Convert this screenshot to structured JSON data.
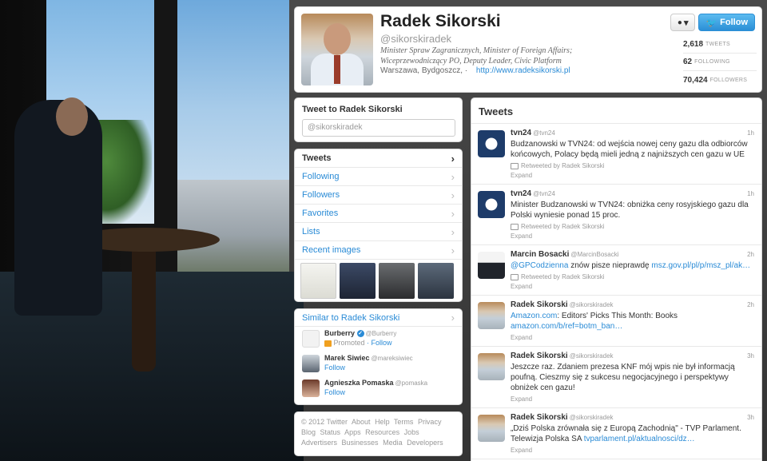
{
  "profile": {
    "name": "Radek Sikorski",
    "handle": "@sikorskiradek",
    "bio": "Minister Spraw Zagranicznych, Minister of Foreign Affairs; Wiceprzewodniczący PO, Deputy Leader, Civic Platform",
    "location": "Warszawa, Bydgoszcz, ·",
    "url": "http://www.radeksikorski.pl",
    "user_dropdown_label": "▾",
    "follow_label": "Follow",
    "stats": [
      {
        "value": "2,618",
        "label": "TWEETS"
      },
      {
        "value": "62",
        "label": "FOLLOWING"
      },
      {
        "value": "70,424",
        "label": "FOLLOWERS"
      }
    ]
  },
  "tweet_to": {
    "title": "Tweet to Radek Sikorski",
    "placeholder": "@sikorskiradek"
  },
  "nav": {
    "items": [
      {
        "label": "Tweets"
      },
      {
        "label": "Following"
      },
      {
        "label": "Followers"
      },
      {
        "label": "Favorites"
      },
      {
        "label": "Lists"
      },
      {
        "label": "Recent images"
      }
    ]
  },
  "similar": {
    "title": "Similar to Radek Sikorski",
    "users": [
      {
        "name": "Burberry",
        "handle": "@Burberry",
        "promoted": "Promoted",
        "follow": "Follow"
      },
      {
        "name": "Marek Siwiec",
        "handle": "@mareksiwiec",
        "follow": "Follow"
      },
      {
        "name": "Agnieszka Pomaska",
        "handle": "@pomaska",
        "follow": "Follow"
      }
    ]
  },
  "footer": {
    "links": [
      "© 2012 Twitter",
      "About",
      "Help",
      "Terms",
      "Privacy",
      "Blog",
      "Status",
      "Apps",
      "Resources",
      "Jobs",
      "Advertisers",
      "Businesses",
      "Media",
      "Developers"
    ]
  },
  "tweets": {
    "header": "Tweets",
    "items": [
      {
        "name": "tvn24",
        "handle": "@tvn24",
        "time": "1h",
        "text": "Budzanowski w TVN24: od wejścia nowej ceny gazu dla odbiorców końcowych, Polacy będą mieli jedną z najniższych cen gazu w UE",
        "link": "",
        "retweet": "Retweeted by Radek Sikorski",
        "expand": "Expand"
      },
      {
        "name": "tvn24",
        "handle": "@tvn24",
        "time": "1h",
        "text": "Minister Budzanowski w TVN24: obniżka ceny rosyjskiego gazu dla Polski wyniesie ponad 15 proc.",
        "link": "",
        "retweet": "Retweeted by Radek Sikorski",
        "expand": "Expand"
      },
      {
        "name": "Marcin Bosacki",
        "handle": "@MarcinBosacki",
        "time": "2h",
        "mention": "@GPCodzienna",
        "text": " znów pisze nieprawdę ",
        "link": "msz.gov.pl/pl/p/msz_pl/ak…",
        "retweet": "Retweeted by Radek Sikorski",
        "expand": "Expand"
      },
      {
        "name": "Radek Sikorski",
        "handle": "@sikorskiradek",
        "time": "2h",
        "link_pre": "Amazon.com",
        "text": ": Editors' Picks This Month: Books ",
        "link": "amazon.com/b/ref=botm_ban…",
        "retweet": "",
        "expand": "Expand"
      },
      {
        "name": "Radek Sikorski",
        "handle": "@sikorskiradek",
        "time": "3h",
        "text": "Jeszcze raz. Zdaniem prezesa KNF mój wpis nie był informacją poufną. Cieszmy się z sukcesu negocjacyjnego i perspektywy obniżek cen gazu!",
        "link": "",
        "retweet": "",
        "expand": "Expand"
      },
      {
        "name": "Radek Sikorski",
        "handle": "@sikorskiradek",
        "time": "3h",
        "text": "„Dziś Polska zrównała się z Europą Zachodnią\" - TVP Parlament. Telewizja Polska SA ",
        "link": "tvparlament.pl/aktualnosci/dz…",
        "retweet": "",
        "expand": "Expand"
      }
    ]
  },
  "colors": {
    "accent": "#2a8bd6",
    "follow_button": "#2b8fd6",
    "promoted": "#f0a020"
  }
}
